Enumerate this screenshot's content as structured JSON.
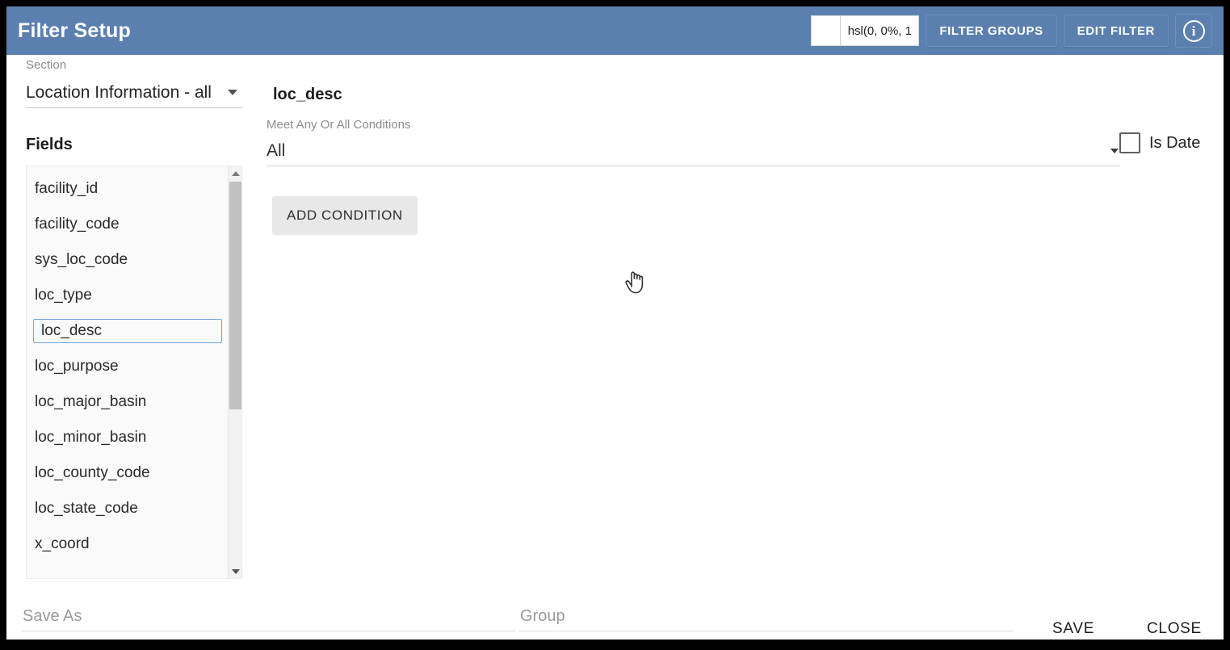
{
  "header": {
    "title": "Filter Setup",
    "color_picker": {
      "swatch_color": "#ffffff",
      "value": "hsl(0, 0%, 1"
    },
    "filter_groups_label": "FILTER GROUPS",
    "edit_filter_label": "EDIT FILTER",
    "info_glyph": "i",
    "bar_color": "#5b80b0"
  },
  "sidebar": {
    "section_label": "Section",
    "section_value": "Location Information - all",
    "fields_title": "Fields",
    "fields": [
      {
        "name": "facility_id",
        "selected": false
      },
      {
        "name": "facility_code",
        "selected": false
      },
      {
        "name": "sys_loc_code",
        "selected": false
      },
      {
        "name": "loc_type",
        "selected": false
      },
      {
        "name": "loc_desc",
        "selected": true
      },
      {
        "name": "loc_purpose",
        "selected": false
      },
      {
        "name": "loc_major_basin",
        "selected": false
      },
      {
        "name": "loc_minor_basin",
        "selected": false
      },
      {
        "name": "loc_county_code",
        "selected": false
      },
      {
        "name": "loc_state_code",
        "selected": false
      },
      {
        "name": "x_coord",
        "selected": false
      }
    ],
    "selection_border_color": "#6ea8dd"
  },
  "main": {
    "field_name": "loc_desc",
    "conditions_label": "Meet Any Or All Conditions",
    "conditions_value": "All",
    "is_date_label": "Is Date",
    "is_date_checked": false,
    "add_condition_label": "ADD CONDITION"
  },
  "footer": {
    "save_as_value": "",
    "save_as_placeholder": "Save As",
    "group_value": "",
    "group_placeholder": "Group",
    "save_label": "SAVE",
    "close_label": "CLOSE"
  }
}
